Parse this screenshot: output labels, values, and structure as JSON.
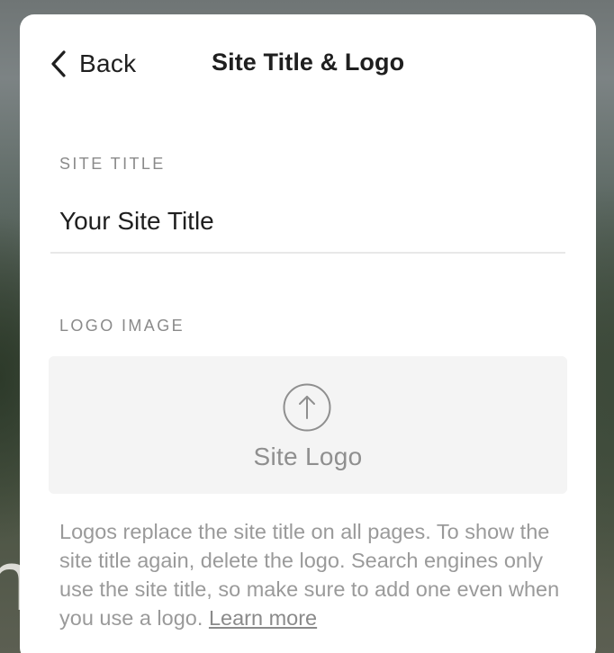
{
  "header": {
    "back_label": "Back",
    "title": "Site Title & Logo"
  },
  "site_title": {
    "label": "SITE TITLE",
    "value": "Your Site Title"
  },
  "logo": {
    "label": "LOGO IMAGE",
    "upload_label": "Site Logo",
    "upload_icon": "upload-arrow-icon"
  },
  "help": {
    "text": "Logos replace the site title on all pages. To show the site title again, delete the logo. Search engines only use the site title, so make sure to add one even when you use a logo. ",
    "link_label": "Learn more"
  },
  "background": {
    "partial_letter": "n"
  },
  "colors": {
    "panel": "#ffffff",
    "text_primary": "#1f1f1f",
    "text_muted": "#8a8a8a",
    "upload_bg": "#f4f4f4"
  }
}
